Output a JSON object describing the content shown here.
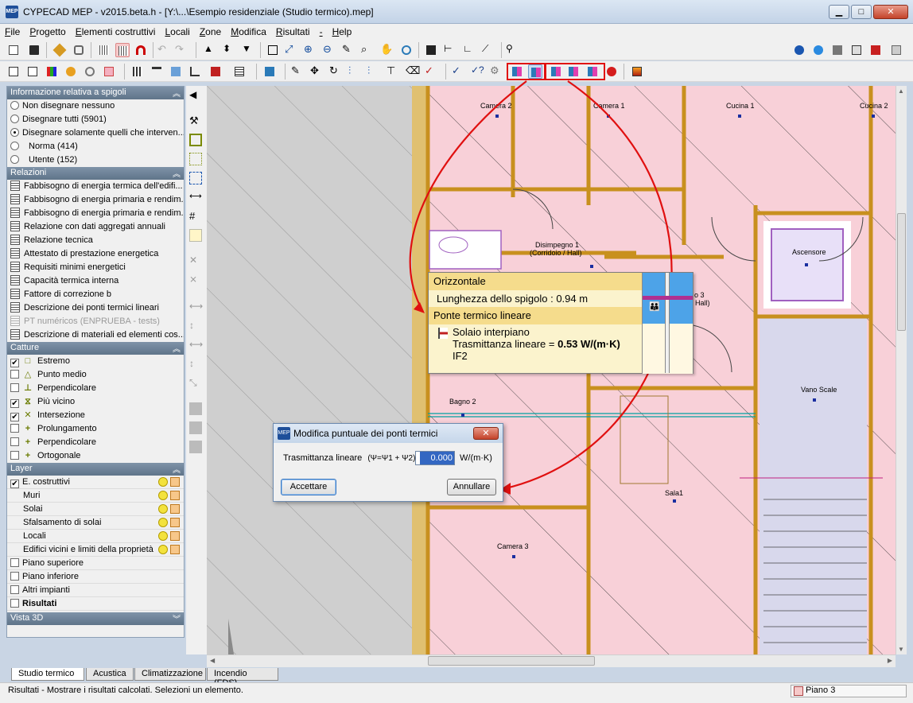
{
  "window": {
    "app_icon": "MEP",
    "title": "CYPECAD MEP - v2015.beta.h - [Y:\\...\\Esempio residenziale (Studio termico).mep]",
    "minimize": "▁",
    "maximize": "□",
    "close": "✕"
  },
  "menu": [
    "File",
    "Progetto",
    "Elementi costruttivi",
    "Locali",
    "Zone",
    "Modifica",
    "Risultati",
    "-",
    "Help"
  ],
  "panel": {
    "info_header": "Informazione relativa a spigoli",
    "info_items": [
      {
        "label": "Non disegnare nessuno",
        "selected": false,
        "indent": false
      },
      {
        "label": "Disegnare tutti (5901)",
        "selected": false,
        "indent": false
      },
      {
        "label": "Disegnare solamente quelli che interven...",
        "selected": true,
        "indent": false
      },
      {
        "label": "Norma (414)",
        "selected": false,
        "indent": true
      },
      {
        "label": "Utente (152)",
        "selected": false,
        "indent": true
      }
    ],
    "relazioni_header": "Relazioni",
    "relazioni": [
      {
        "label": "Fabbisogno di energia termica dell'edifi...",
        "disabled": false
      },
      {
        "label": "Fabbisogno di energia primaria e rendim...",
        "disabled": false
      },
      {
        "label": "Fabbisogno di energia primaria e rendim...",
        "disabled": false
      },
      {
        "label": "Relazione con dati aggregati annuali",
        "disabled": false
      },
      {
        "label": "Relazione tecnica",
        "disabled": false
      },
      {
        "label": "Attestato di prestazione energetica",
        "disabled": false
      },
      {
        "label": "Requisiti minimi energetici",
        "disabled": false
      },
      {
        "label": "Capacità termica interna",
        "disabled": false
      },
      {
        "label": "Fattore di correzione b",
        "disabled": false
      },
      {
        "label": "Descrizione dei ponti termici lineari",
        "disabled": false
      },
      {
        "label": "PT numéricos (ENPRUEBA - tests)",
        "disabled": true
      },
      {
        "label": "Descrizione di materiali ed elementi cos...",
        "disabled": false
      }
    ],
    "catture_header": "Catture",
    "catture": [
      {
        "label": "Estremo",
        "checked": true,
        "icon": "□"
      },
      {
        "label": "Punto medio",
        "checked": false,
        "icon": "△"
      },
      {
        "label": "Perpendicolare",
        "checked": false,
        "icon": "⊥"
      },
      {
        "label": "Più vicino",
        "checked": true,
        "icon": "⧖"
      },
      {
        "label": "Intersezione",
        "checked": true,
        "icon": "✕"
      },
      {
        "label": "Prolungamento",
        "checked": false,
        "icon": "+"
      },
      {
        "label": "Perpendicolare",
        "checked": false,
        "icon": "+"
      },
      {
        "label": "Ortogonale",
        "checked": false,
        "icon": "+"
      }
    ],
    "layer_header": "Layer",
    "layers": [
      {
        "label": "E. costruttivi",
        "checkbox": true,
        "checked": true,
        "icons": true,
        "bold": false
      },
      {
        "label": "Muri",
        "checkbox": false,
        "checked": false,
        "icons": true,
        "bold": false
      },
      {
        "label": "Solai",
        "checkbox": false,
        "checked": false,
        "icons": true,
        "bold": false
      },
      {
        "label": "Sfalsamento di solai",
        "checkbox": false,
        "checked": false,
        "icons": true,
        "bold": false
      },
      {
        "label": "Locali",
        "checkbox": false,
        "checked": false,
        "icons": true,
        "bold": false
      },
      {
        "label": "Edifici vicini e limiti della proprietà",
        "checkbox": false,
        "checked": false,
        "icons": true,
        "bold": false
      },
      {
        "label": "Piano superiore",
        "checkbox": true,
        "checked": false,
        "icons": false,
        "bold": false
      },
      {
        "label": "Piano inferiore",
        "checkbox": true,
        "checked": false,
        "icons": false,
        "bold": false
      },
      {
        "label": "Altri impianti",
        "checkbox": true,
        "checked": false,
        "icons": false,
        "bold": false
      },
      {
        "label": "Risultati",
        "checkbox": true,
        "checked": false,
        "icons": false,
        "bold": true
      }
    ],
    "vista_header": "Vista 3D"
  },
  "plan_labels": {
    "camera2": "Camera 2",
    "camera1": "Camera 1",
    "cucina1": "Cucina 1",
    "cucina2": "Cucina 2",
    "disimpegno": "Disimpegno 1",
    "disimpegno_sub": "(Corridoio / Hall)",
    "ascensore": "Ascensore",
    "vano_scale": "Vano Scale",
    "bagno2": "Bagno 2",
    "sala1": "Sala1",
    "camera3": "Camera 3",
    "hall_fragment": "o 3",
    "hall_fragment2": "Hall)"
  },
  "infocard": {
    "header": "Orizzontale",
    "length": "Lunghezza dello spigolo : 0.94 m",
    "section": "Ponte termico lineare",
    "type": "Solaio interpiano",
    "trasmittanza_label": "Trasmittanza lineare = ",
    "trasmittanza_value": "0.53 W/(m·K)",
    "code": "IF2"
  },
  "dialog": {
    "title": "Modifica puntuale dei ponti termici",
    "field_label": "Trasmittanza lineare",
    "formula": "(Ψ=Ψ1 + Ψ2)",
    "value": "0.000",
    "unit": "W/(m·K)",
    "accept": "Accettare",
    "cancel": "Annullare"
  },
  "tabs": [
    "Studio termico",
    "Acustica",
    "Climatizzazione",
    "Incendio (FDS)"
  ],
  "status": {
    "message": "Risultati - Mostrare i risultati calcolati.  Selezioni un elemento.",
    "floor": "Piano 3"
  },
  "colors": {
    "room_fill": "#f8d0d8",
    "wall": "#c8901e",
    "highlight": "#e01010",
    "panel_head": "#6f8499"
  }
}
